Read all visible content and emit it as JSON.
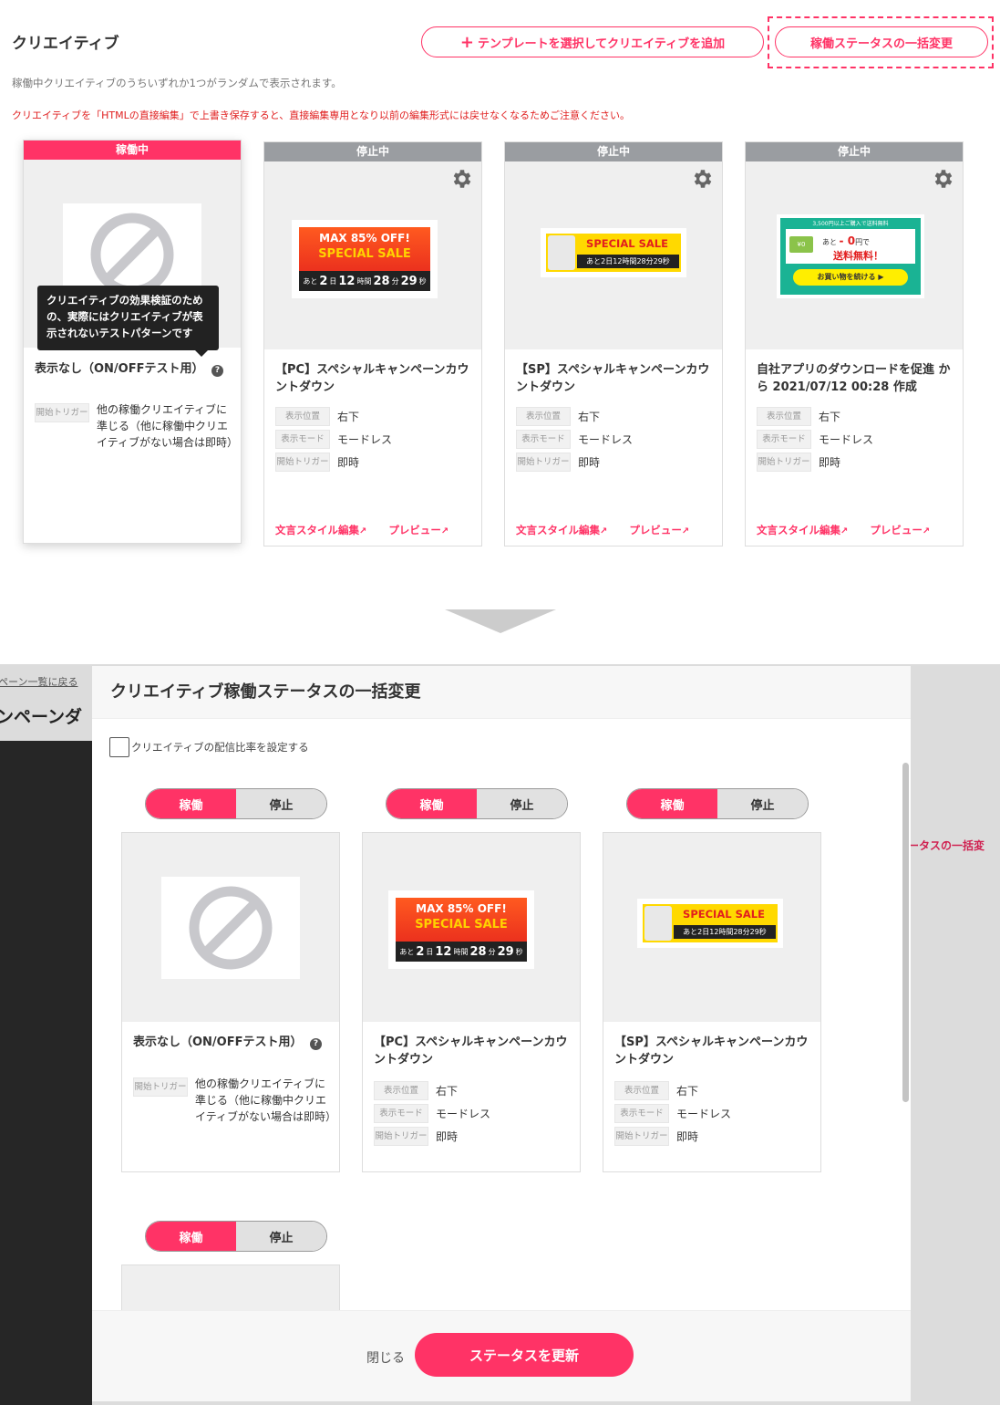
{
  "top": {
    "title": "クリエイティブ",
    "add_button_plus": "+",
    "add_button": "テンプレートを選択してクリエイティブを追加",
    "status_button": "稼働ステータスの一括変更",
    "info": "稼働中クリエイティブのうちいずれか1つがランダムで表示されます。",
    "warning": "クリエイティブを「HTMLの直接編集」で上書き保存すると、直接編集専用となり以前の編集形式には戻せなくなるためご注意ください。",
    "tooltip": "クリエイティブの効果検証のための、実際にはクリエイティブが表示されないテストパターンです",
    "help_icon_glyph": "?",
    "cards": [
      {
        "status": "稼働中",
        "title": "表示なし（ON/OFFテスト用）",
        "trigger_label": "開始トリガー",
        "trigger_value": "他の稼働クリエイティブに準じる（他に稼働中クリエイティブがない場合は即時）"
      },
      {
        "status": "停止中",
        "title": "【PC】スペシャルキャンペーンカウントダウン",
        "pos_label": "表示位置",
        "pos_value": "右下",
        "mode_label": "表示モード",
        "mode_value": "モードレス",
        "trigger_label": "開始トリガー",
        "trigger_value": "即時",
        "edit_link": "文言スタイル編集",
        "preview_link": "プレビュー"
      },
      {
        "status": "停止中",
        "title": "【SP】スペシャルキャンペーンカウントダウン",
        "pos_label": "表示位置",
        "pos_value": "右下",
        "mode_label": "表示モード",
        "mode_value": "モードレス",
        "trigger_label": "開始トリガー",
        "trigger_value": "即時",
        "edit_link": "文言スタイル編集",
        "preview_link": "プレビュー"
      },
      {
        "status": "停止中",
        "title": "自社アプリのダウンロードを促進 から 2021/07/12 00:28 作成",
        "pos_label": "表示位置",
        "pos_value": "右下",
        "mode_label": "表示モード",
        "mode_value": "モードレス",
        "trigger_label": "開始トリガー",
        "trigger_value": "即時",
        "edit_link": "文言スタイル編集",
        "preview_link": "プレビュー"
      }
    ]
  },
  "banner_pc": {
    "line1": "MAX 85% OFF!",
    "line2": "SPECIAL SALE",
    "ato": "あと",
    "d": "2",
    "d_unit": "日",
    "h": "12",
    "h_unit": "時間",
    "m": "28",
    "m_unit": "分",
    "s": "29",
    "s_unit": "秒"
  },
  "banner_sp": {
    "line1": "SPECIAL SALE",
    "countdown": "あと2日12時間28分29秒"
  },
  "banner_app": {
    "top": "3,500円以上ご購入で送料無料",
    "ato": "あと",
    "amount": "- 0",
    "yen": "円で",
    "free": "送料無料！",
    "badge": "¥0",
    "button": "お買い物を続ける ▶"
  },
  "background": {
    "breadcrumb": "ペーン一覧に戻る",
    "title": "ンペーンダ",
    "right_button": "ータスの一括変"
  },
  "modal": {
    "title": "クリエイティブ稼働ステータスの一括変更",
    "ratio_label": "クリエイティブの配信比率を設定する",
    "toggle_on": "稼働",
    "toggle_off": "停止",
    "close": "閉じる",
    "update": "ステータスを更新"
  },
  "colors": {
    "accent": "#ff3366",
    "stopped": "#9a9da1"
  }
}
